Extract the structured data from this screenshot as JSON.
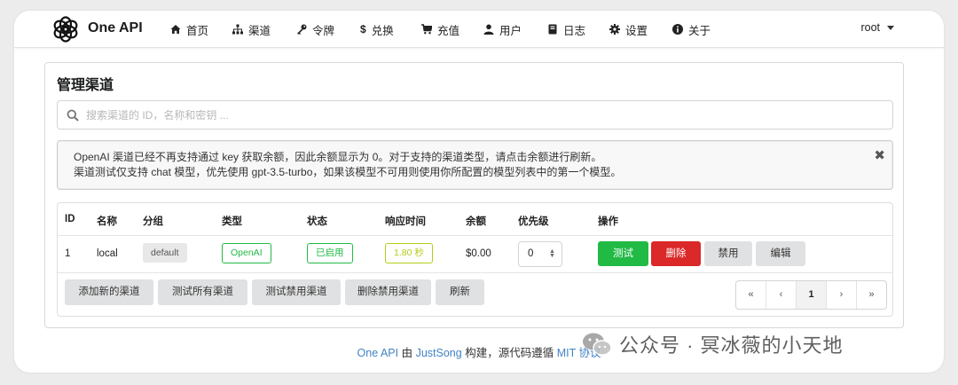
{
  "app": {
    "name": "One API"
  },
  "nav": {
    "items": [
      {
        "label": "首页",
        "icon": "home-icon"
      },
      {
        "label": "渠道",
        "icon": "sitemap-icon"
      },
      {
        "label": "令牌",
        "icon": "key-icon"
      },
      {
        "label": "兑换",
        "icon": "dollar-icon"
      },
      {
        "label": "充值",
        "icon": "cart-icon"
      },
      {
        "label": "用户",
        "icon": "user-icon"
      },
      {
        "label": "日志",
        "icon": "book-icon"
      },
      {
        "label": "设置",
        "icon": "gear-icon"
      },
      {
        "label": "关于",
        "icon": "info-icon"
      }
    ],
    "user": "root"
  },
  "page": {
    "title": "管理渠道",
    "search_placeholder": "搜索渠道的 ID，名称和密钥 ...",
    "notice_line1": "OpenAI 渠道已经不再支持通过 key 获取余额，因此余额显示为 0。对于支持的渠道类型，请点击余额进行刷新。",
    "notice_line2": "渠道测试仅支持 chat 模型，优先使用 gpt-3.5-turbo，如果该模型不可用则使用你所配置的模型列表中的第一个模型。"
  },
  "table": {
    "headers": [
      "ID",
      "名称",
      "分组",
      "类型",
      "状态",
      "响应时间",
      "余额",
      "优先级",
      "操作"
    ],
    "rows": [
      {
        "id": "1",
        "name": "local",
        "group": "default",
        "type": "OpenAI",
        "status": "已启用",
        "response_time": "1.80 秒",
        "balance": "$0.00",
        "priority": "0",
        "actions": {
          "test": "测试",
          "delete": "删除",
          "disable": "禁用",
          "edit": "编辑"
        }
      }
    ],
    "footer_buttons": {
      "add": "添加新的渠道",
      "test_all": "测试所有渠道",
      "test_disabled": "测试禁用渠道",
      "delete_disabled": "删除禁用渠道",
      "refresh": "刷新"
    },
    "pagination": {
      "first": "«",
      "prev": "‹",
      "current": "1",
      "next": "›",
      "last": "»"
    }
  },
  "footer": {
    "app_link": "One API",
    "by": "由",
    "author": "JustSong",
    "built": "构建，源代码遵循",
    "license": "MIT 协议"
  },
  "watermark": "公众号 · 冥冰薇的小天地",
  "colors": {
    "type_label": "#21ba45",
    "status_label": "#21ba45",
    "response_label": "#b5cc18",
    "test_button": "#21ba45",
    "delete_button": "#db2828",
    "link": "#4183c4"
  }
}
